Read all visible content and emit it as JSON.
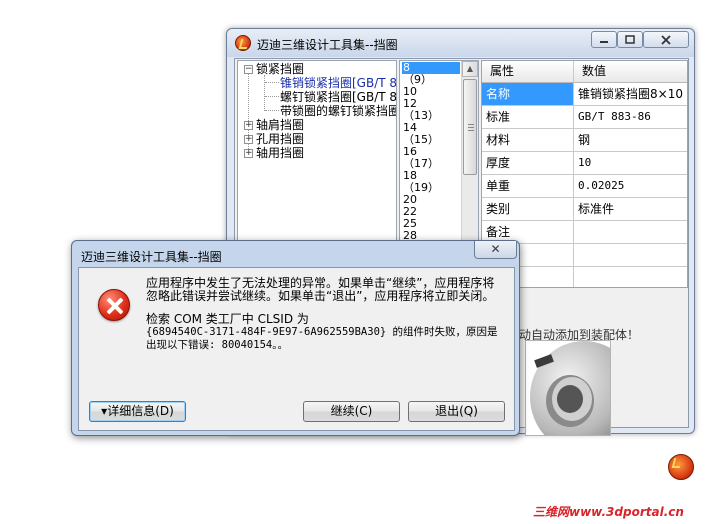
{
  "main_window": {
    "title": "迈迪三维设计工具集--挡圈",
    "controls": {
      "minimize": "▭",
      "maximize": "◻",
      "close": "✕"
    }
  },
  "tree": {
    "items": [
      {
        "label": "锁紧挡圈",
        "expander": "−"
      },
      {
        "label": "锥销锁紧挡圈[GB/T 8"
      },
      {
        "label": "螺钉锁紧挡圈[GB/T 8"
      },
      {
        "label": "带锁圈的螺钉锁紧挡圈"
      },
      {
        "label": "轴肩挡圈",
        "expander": "+"
      },
      {
        "label": "孔用挡圈",
        "expander": "+"
      },
      {
        "label": "轴用挡圈",
        "expander": "+"
      }
    ]
  },
  "size_list": {
    "items": [
      "8",
      "（9）",
      "10",
      "12",
      "（13）",
      "14",
      "（15）",
      "16",
      "（17）",
      "18",
      "（19）",
      "20",
      "22",
      "25",
      "28"
    ],
    "selected": "8"
  },
  "properties": {
    "header": {
      "name": "属性",
      "value": "数值"
    },
    "rows": [
      {
        "name": "名称",
        "value": "锥销锁紧挡圈8×10"
      },
      {
        "name": "标准",
        "value": "GB/T 883-86"
      },
      {
        "name": "材料",
        "value": "钢"
      },
      {
        "name": "厚度",
        "value": "10"
      },
      {
        "name": "单重",
        "value": "0.02025"
      },
      {
        "name": "类别",
        "value": "标准件"
      },
      {
        "name": "备注",
        "value": ""
      },
      {
        "name": "",
        "value": ""
      },
      {
        "name": "",
        "value": ""
      }
    ]
  },
  "hint": "动自动添加到装配体！",
  "dialog": {
    "title": "迈迪三维设计工具集--挡圈",
    "close": "✕",
    "message_1": "应用程序中发生了无法处理的异常。如果单击“继续”，应用程序将忽略此错误并尝试继续。如果单击“退出”，应用程序将立即关闭。",
    "message_2a": "检索 COM 类工厂中 CLSID 为",
    "message_2b": "{6894540C-3171-484F-9E97-6A962559BA30} 的组件时失败，原因是出现以下错误: 80040154。。",
    "details_button": "▾详细信息(D)",
    "continue_button": "继续(C)",
    "quit_button": "退出(Q)"
  },
  "watermark": "三维网www.3dportal.cn",
  "colors": {
    "selection": "#3399ff",
    "title_bar": "#c9d7ea",
    "watermark": "#d8242a"
  }
}
